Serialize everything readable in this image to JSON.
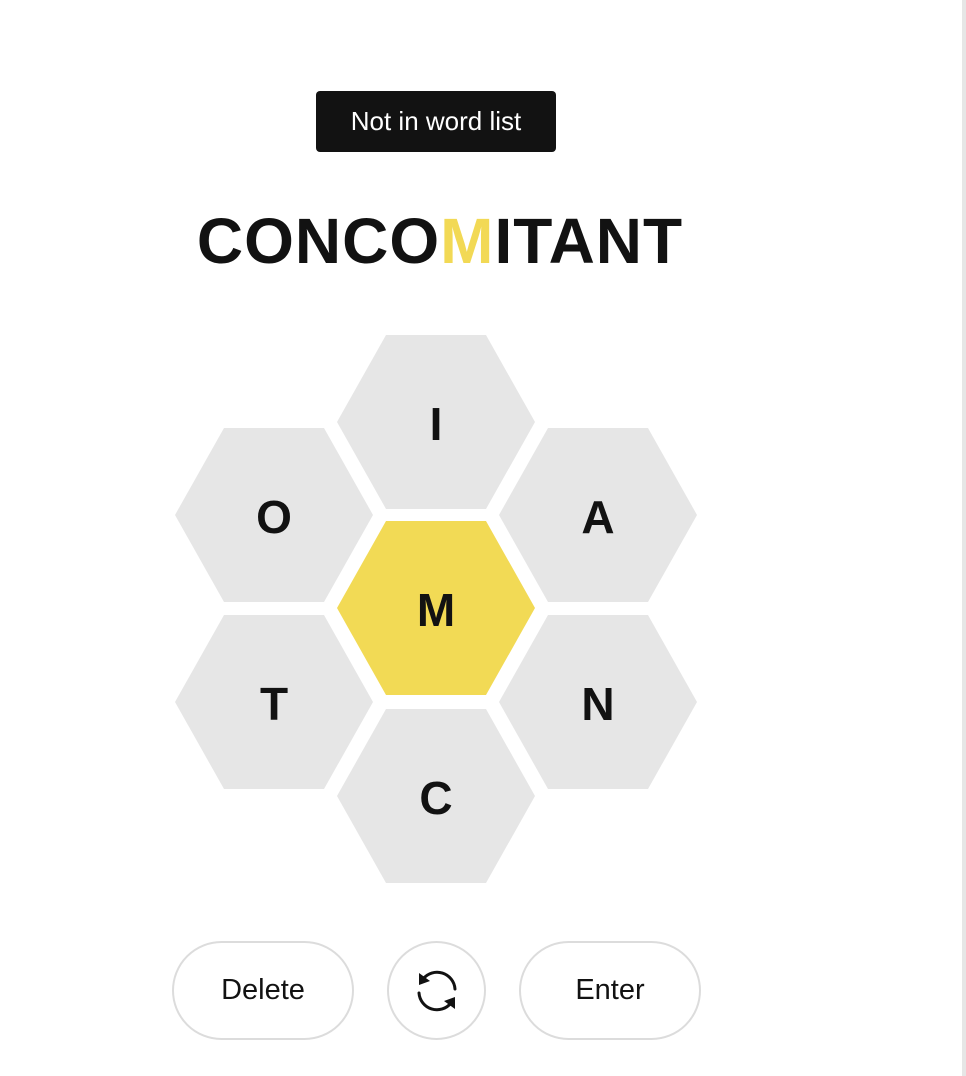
{
  "toast": {
    "message": "Not in word list"
  },
  "input": {
    "before_center": "CONCO",
    "center_letter": "M",
    "after_center": "ITANT",
    "colors": {
      "text": "#121212",
      "center": "#f2d955"
    }
  },
  "hive": {
    "center": "M",
    "top": "I",
    "upper_left": "O",
    "upper_right": "A",
    "lower_left": "T",
    "lower_right": "N",
    "bottom": "C",
    "colors": {
      "outer": "#e6e6e6",
      "center": "#f2da55"
    }
  },
  "controls": {
    "delete_label": "Delete",
    "shuffle_icon": "shuffle-icon",
    "enter_label": "Enter"
  }
}
